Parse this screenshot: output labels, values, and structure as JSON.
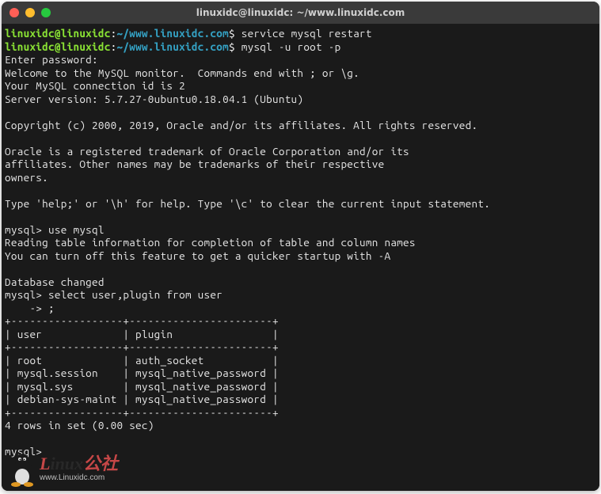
{
  "window": {
    "title": "linuxidc@linuxidc: ~/www.linuxidc.com"
  },
  "prompt": {
    "userhost": "linuxidc@linuxidc",
    "colon": ":",
    "path": "~/www.linuxidc.com",
    "dollar": "$"
  },
  "lines": {
    "cmd1": " service mysql restart",
    "cmd2": " mysql -u root -p",
    "l3": "Enter password:",
    "l4": "Welcome to the MySQL monitor.  Commands end with ; or \\g.",
    "l5": "Your MySQL connection id is 2",
    "l6": "Server version: 5.7.27-0ubuntu0.18.04.1 (Ubuntu)",
    "l7": "",
    "l8": "Copyright (c) 2000, 2019, Oracle and/or its affiliates. All rights reserved.",
    "l9": "",
    "l10": "Oracle is a registered trademark of Oracle Corporation and/or its",
    "l11": "affiliates. Other names may be trademarks of their respective",
    "l12": "owners.",
    "l13": "",
    "l14": "Type 'help;' or '\\h' for help. Type '\\c' to clear the current input statement.",
    "l15": "",
    "l16": "mysql> use mysql",
    "l17": "Reading table information for completion of table and column names",
    "l18": "You can turn off this feature to get a quicker startup with -A",
    "l19": "",
    "l20": "Database changed",
    "l21": "mysql> select user,plugin from user",
    "l22": "    -> ;",
    "t1": "+------------------+-----------------------+",
    "t2": "| user             | plugin                |",
    "t3": "+------------------+-----------------------+",
    "t4": "| root             | auth_socket           |",
    "t5": "| mysql.session    | mysql_native_password |",
    "t6": "| mysql.sys        | mysql_native_password |",
    "t7": "| debian-sys-maint | mysql_native_password |",
    "t8": "+------------------+-----------------------+",
    "l31": "4 rows in set (0.00 sec)",
    "l32": "",
    "l33": "mysql>"
  },
  "watermark": {
    "brand_l": "L",
    "brand_rest": "inux",
    "brand_cn": "公社",
    "url": "www.Linuxidc.com"
  }
}
